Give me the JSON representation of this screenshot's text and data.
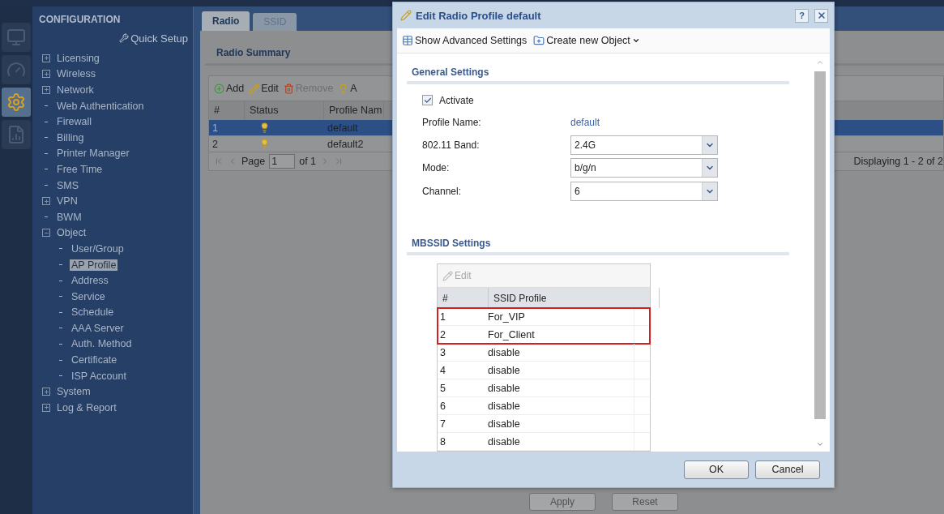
{
  "rail": [
    {
      "kind": "monitor",
      "selected": false
    },
    {
      "kind": "dashboard",
      "selected": false
    },
    {
      "kind": "configuration",
      "selected": true
    },
    {
      "kind": "maintenance",
      "selected": false
    }
  ],
  "nav": {
    "title": "CONFIGURATION",
    "quick_setup": "Quick Setup",
    "items": [
      {
        "label": "Licensing",
        "kind": "group",
        "expanded": false,
        "selected": false
      },
      {
        "label": "Wireless",
        "kind": "group",
        "expanded": false,
        "selected": false
      },
      {
        "label": "Network",
        "kind": "group",
        "expanded": false,
        "selected": false
      },
      {
        "label": "Web Authentication",
        "kind": "leaf",
        "selected": false
      },
      {
        "label": "Firewall",
        "kind": "leaf",
        "selected": false
      },
      {
        "label": "Billing",
        "kind": "leaf",
        "selected": false
      },
      {
        "label": "Printer Manager",
        "kind": "leaf",
        "selected": false
      },
      {
        "label": "Free Time",
        "kind": "leaf",
        "selected": false
      },
      {
        "label": "SMS",
        "kind": "leaf",
        "selected": false
      },
      {
        "label": "VPN",
        "kind": "group",
        "expanded": false,
        "selected": false
      },
      {
        "label": "BWM",
        "kind": "leaf",
        "selected": false
      },
      {
        "label": "Object",
        "kind": "group",
        "expanded": true,
        "selected": false,
        "children": [
          {
            "label": "User/Group",
            "kind": "leaf",
            "selected": false
          },
          {
            "label": "AP Profile",
            "kind": "leaf",
            "selected": true
          },
          {
            "label": "Address",
            "kind": "leaf",
            "selected": false
          },
          {
            "label": "Service",
            "kind": "leaf",
            "selected": false
          },
          {
            "label": "Schedule",
            "kind": "leaf",
            "selected": false
          },
          {
            "label": "AAA Server",
            "kind": "leaf",
            "selected": false
          },
          {
            "label": "Auth. Method",
            "kind": "leaf",
            "selected": false
          },
          {
            "label": "Certificate",
            "kind": "leaf",
            "selected": false
          },
          {
            "label": "ISP Account",
            "kind": "leaf",
            "selected": false
          }
        ]
      },
      {
        "label": "System",
        "kind": "group",
        "expanded": false,
        "selected": false
      },
      {
        "label": "Log & Report",
        "kind": "group",
        "expanded": false,
        "selected": false
      }
    ]
  },
  "tabs": [
    {
      "label": "Radio",
      "selected": true
    },
    {
      "label": "SSID",
      "selected": false
    }
  ],
  "summary": {
    "title": "Radio Summary",
    "toolbar": [
      {
        "label": "Add",
        "kind": "add",
        "disabled": false
      },
      {
        "label": "Edit",
        "kind": "edit",
        "disabled": false
      },
      {
        "label": "Remove",
        "kind": "remove",
        "disabled": true
      },
      {
        "label": "A",
        "kind": "activate",
        "disabled": false
      }
    ],
    "columns": [
      "#",
      "Status",
      "Profile Nam"
    ],
    "rows": [
      {
        "index": "1",
        "active": true,
        "name": "default",
        "selected": true
      },
      {
        "index": "2",
        "active": true,
        "name": "default2",
        "selected": false
      }
    ],
    "pager": {
      "page_label": "Page",
      "page": "1",
      "of": "of 1",
      "displaying": "Displaying 1 - 2 of 2"
    }
  },
  "buttons": [
    "Apply",
    "Reset"
  ],
  "dialog": {
    "title": "Edit Radio Profile default",
    "help": "?",
    "toolbar": [
      {
        "label": "Show Advanced Settings",
        "kind": "advanced",
        "menu": false
      },
      {
        "label": "Create new Object",
        "kind": "create",
        "menu": true
      }
    ],
    "general": {
      "title": "General Settings",
      "activate": {
        "label": "Activate",
        "checked": true
      },
      "profile_name": {
        "label": "Profile Name:",
        "value": "default"
      },
      "fields": [
        {
          "label": "802.11 Band:",
          "value": "2.4G"
        },
        {
          "label": "Mode:",
          "value": "b/g/n"
        },
        {
          "label": "Channel:",
          "value": "6"
        }
      ]
    },
    "mbssid": {
      "title": "MBSSID Settings",
      "edit": {
        "label": "Edit",
        "disabled": true
      },
      "columns": [
        "#",
        "SSID Profile"
      ],
      "rows": [
        {
          "index": "1",
          "profile": "For_VIP",
          "highlighted": true
        },
        {
          "index": "2",
          "profile": "For_Client",
          "highlighted": true
        },
        {
          "index": "3",
          "profile": "disable",
          "highlighted": false
        },
        {
          "index": "4",
          "profile": "disable",
          "highlighted": false
        },
        {
          "index": "5",
          "profile": "disable",
          "highlighted": false
        },
        {
          "index": "6",
          "profile": "disable",
          "highlighted": false
        },
        {
          "index": "7",
          "profile": "disable",
          "highlighted": false
        },
        {
          "index": "8",
          "profile": "disable",
          "highlighted": false
        }
      ]
    },
    "buttons": [
      "OK",
      "Cancel"
    ]
  }
}
